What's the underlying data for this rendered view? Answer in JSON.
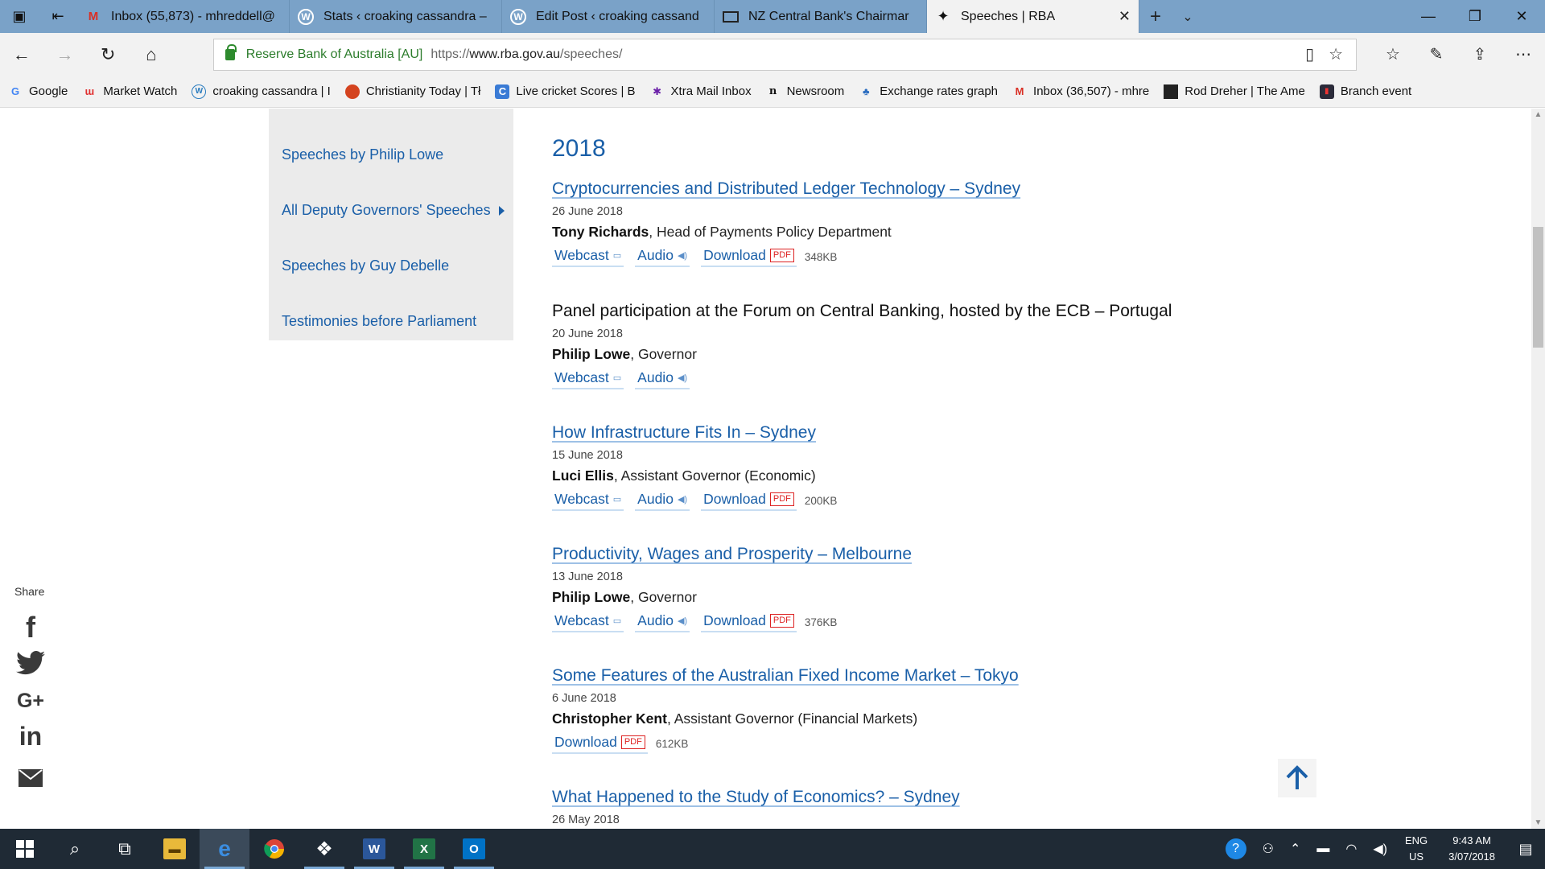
{
  "browser": {
    "tabs": [
      {
        "label": "Inbox (55,873) - mhreddell@",
        "icon": "gmail-icon"
      },
      {
        "label": "Stats ‹ croaking cassandra –",
        "icon": "wordpress-icon"
      },
      {
        "label": "Edit Post ‹ croaking cassand",
        "icon": "wordpress-icon"
      },
      {
        "label": "NZ Central Bank's Chairmar",
        "icon": "news-icon"
      },
      {
        "label": "Speeches | RBA",
        "icon": "rba-icon",
        "active": true
      }
    ],
    "address": {
      "cert_label": "Reserve Bank of Australia [AU]",
      "url_protocol": "https://",
      "url_host": "www.rba.gov.au",
      "url_path": "/speeches/"
    },
    "favorites": [
      {
        "label": "Google"
      },
      {
        "label": "Market Watch"
      },
      {
        "label": "croaking cassandra | I"
      },
      {
        "label": "Christianity Today | Tł"
      },
      {
        "label": "Live cricket Scores | B"
      },
      {
        "label": "Xtra Mail Inbox"
      },
      {
        "label": "Newsroom"
      },
      {
        "label": "Exchange rates graph"
      },
      {
        "label": "Inbox (36,507) - mhre"
      },
      {
        "label": "Rod Dreher | The Ame"
      },
      {
        "label": "Branch event"
      }
    ]
  },
  "sidebar": {
    "items": [
      {
        "label": "Speeches by Philip Lowe"
      },
      {
        "label": "All Deputy Governors' Speeches"
      },
      {
        "label": "Speeches by Guy Debelle"
      },
      {
        "label": "Testimonies before Parliament"
      }
    ]
  },
  "main": {
    "year": "2018",
    "speeches": [
      {
        "title": "Cryptocurrencies and Distributed Ledger Technology – Sydney",
        "date": "26 June 2018",
        "speaker": "Tony Richards",
        "role": ", Head of Payments Policy Department",
        "webcast": "Webcast",
        "audio": "Audio",
        "download": "Download",
        "pdf": "PDF",
        "size": "348KB"
      },
      {
        "title": "Panel participation at the Forum on Central Banking, hosted by the ECB – Portugal",
        "date": "20 June 2018",
        "speaker": "Philip Lowe",
        "role": ", Governor",
        "webcast": "Webcast",
        "audio": "Audio"
      },
      {
        "title": "How Infrastructure Fits In – Sydney",
        "date": "15 June 2018",
        "speaker": "Luci Ellis",
        "role": ", Assistant Governor (Economic)",
        "webcast": "Webcast",
        "audio": "Audio",
        "download": "Download",
        "pdf": "PDF",
        "size": "200KB"
      },
      {
        "title": "Productivity, Wages and Prosperity – Melbourne",
        "date": "13 June 2018",
        "speaker": "Philip Lowe",
        "role": ", Governor",
        "webcast": "Webcast",
        "audio": "Audio",
        "download": "Download",
        "pdf": "PDF",
        "size": "376KB"
      },
      {
        "title": "Some Features of the Australian Fixed Income Market – Tokyo",
        "date": "6 June 2018",
        "speaker": "Christopher Kent",
        "role": ", Assistant Governor (Financial Markets)",
        "download": "Download",
        "pdf": "PDF",
        "size": "612KB"
      },
      {
        "title": "What Happened to the Study of Economics? – Sydney",
        "date": "26 May 2018"
      }
    ]
  },
  "share": {
    "label": "Share",
    "networks": [
      "facebook-icon",
      "twitter-icon",
      "google-plus-icon",
      "linkedin-icon",
      "email-icon"
    ]
  },
  "taskbar": {
    "lang_line1": "ENG",
    "lang_line2": "US",
    "time": "9:43 AM",
    "date": "3/07/2018"
  },
  "colors": {
    "link": "#1a5fa8",
    "tabbar": "#7aa2c8",
    "taskbar": "#1f2a35",
    "sidebar_bg": "#ebebeb"
  }
}
